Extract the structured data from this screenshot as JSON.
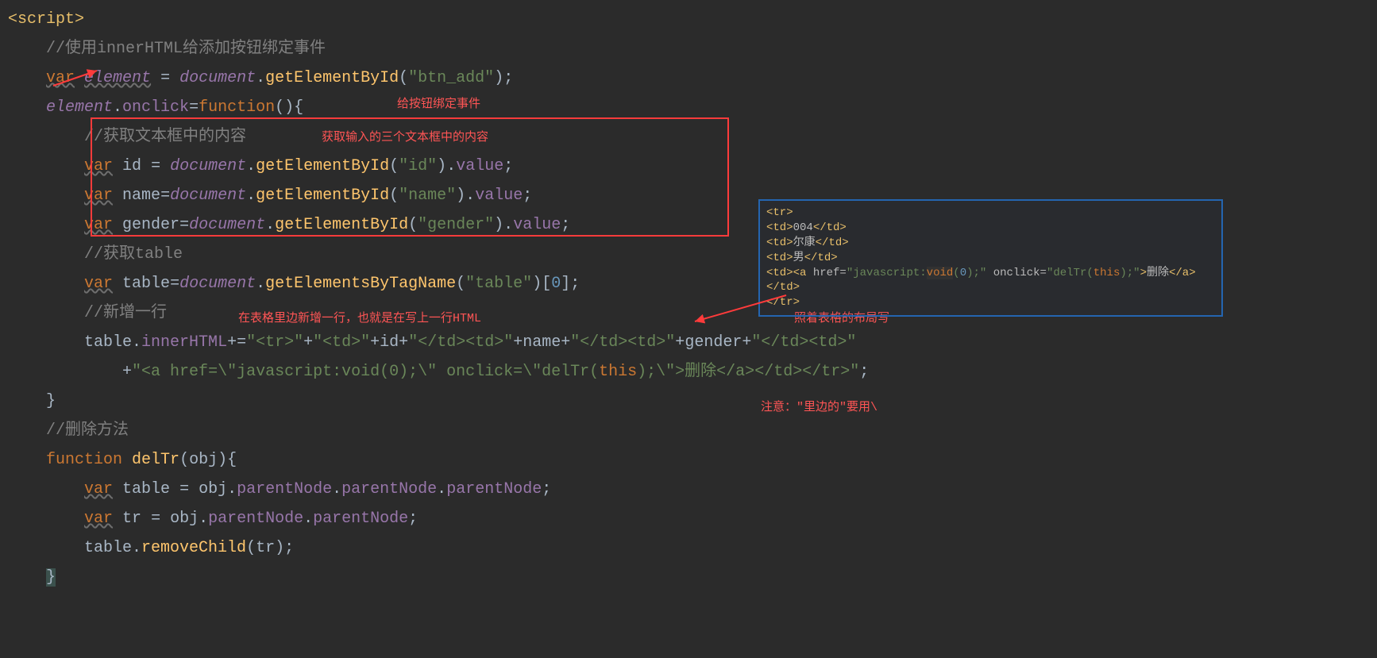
{
  "lines": {
    "l1": "<script>",
    "l2_cmt": "//使用innerHTML给添加按钮绑定事件",
    "l3": {
      "var": "var",
      "elname": "element",
      "eq": " = ",
      "doc": "document",
      "dot": ".",
      "fn": "getElementById",
      "lp": "(",
      "str": "\"btn_add\"",
      "rp": ");"
    },
    "l4": {
      "elname": "element",
      "dot": ".",
      "prop": "onclick",
      "eq": "=",
      "fn": "function",
      "paren": "(){ "
    },
    "l5_cmt": "//获取文本框中的内容",
    "l6": {
      "var": "var",
      "id": "id",
      "eq": " = ",
      "doc": "document",
      "fn": "getElementById",
      "str": "\"id\"",
      "dot2": ".",
      "val": "value",
      "end": ";"
    },
    "l7": {
      "var": "var",
      "id": "name",
      "eq": "=",
      "doc": "document",
      "fn": "getElementById",
      "str": "\"name\"",
      "val": "value",
      "end": ";"
    },
    "l8": {
      "var": "var",
      "id": "gender",
      "eq": "=",
      "doc": "document",
      "fn": "getElementById",
      "str": "\"gender\"",
      "val": "value",
      "end": ";"
    },
    "l9_cmt": "//获取table",
    "l10": {
      "var": "var",
      "id": "table",
      "eq": "=",
      "doc": "document",
      "fn": "getElementsByTagName",
      "str": "\"table\"",
      "br": "[",
      "num": "0",
      "br2": "];"
    },
    "l11_cmt": "//新增一行",
    "l12": {
      "tbl": "table",
      "dot": ".",
      "prop": "innerHTML",
      "op": "+=",
      "s1": "\"<tr>\"",
      "p": "+",
      "s2": "\"<td>\"",
      "id": "id",
      "s3": "\"</td><td>\"",
      "name": "name",
      "s4": "\"</td><td>\"",
      "gender": "gender",
      "s5": "\"</td><td>\""
    },
    "l13": {
      "p": "+",
      "s1": "\"<a href=\\\"javascript:void(0);\\\" onclick=\\\"delTr(",
      "this": "this",
      "s2": ");\\\">删除</a></td></tr>\"",
      "end": ";"
    },
    "l14": "}",
    "l15_cmt": "//删除方法",
    "l16": {
      "fn": "function",
      "name": "delTr",
      "lp": "(",
      "param": "obj",
      "rp": ")",
      "br": "{"
    },
    "l17": {
      "var": "var",
      "id": "table",
      "eq": " = ",
      "obj": "obj",
      "p1": "parentNode",
      "p2": "parentNode",
      "p3": "parentNode",
      "end": ";"
    },
    "l18": {
      "var": "var",
      "id": "tr",
      "eq": " = ",
      "obj": "obj",
      "p1": "parentNode",
      "p2": "parentNode",
      "end": ";"
    },
    "l19": {
      "tbl": "table",
      "fn": "removeChild",
      "arg": "tr",
      "end": ";"
    },
    "l20": "}"
  },
  "annotations": {
    "a1": "给按钮绑定事件",
    "a2": "获取输入的三个文本框中的内容",
    "a3": "在表格里边新增一行，也就是在写上一行HTML",
    "a4": "照着表格的布局写",
    "a5": "注意：\"里边的\"要用\\"
  },
  "tooltip": {
    "l1": "<tr>",
    "l2a": "<td>",
    "l2b": "004",
    "l2c": "</td>",
    "l3a": "<td>",
    "l3b": "尔康",
    "l3c": "</td>",
    "l4a": "<td>",
    "l4b": "男",
    "l4c": "</td>",
    "l5a": "<td><a",
    "l5b": " href=",
    "l5c": "\"javascript:",
    "l5d": "void",
    "l5e": "(",
    "l5f": "0",
    "l5g": ");\"",
    "l5h": " onclick=",
    "l5i": "\"delTr(",
    "l5j": "this",
    "l5k": ");\"",
    "l5l": ">",
    "l5m": "删除",
    "l5n": "</a></td>",
    "l6": "</tr>"
  }
}
